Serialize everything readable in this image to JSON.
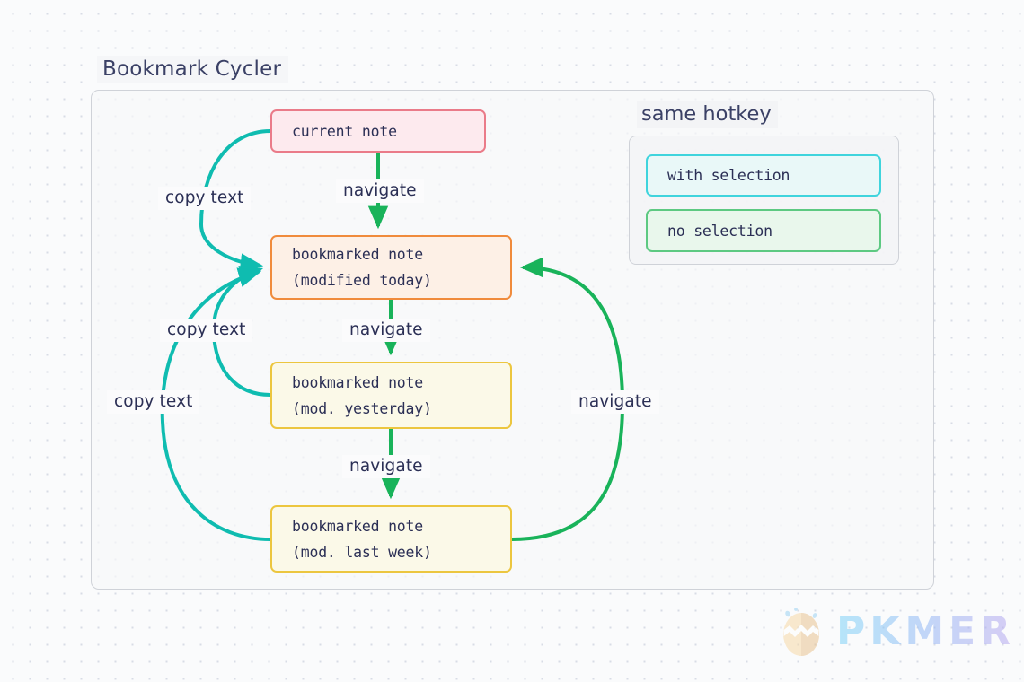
{
  "diagram": {
    "title": "Bookmark Cycler",
    "nodes": [
      {
        "id": "current",
        "label_line1": "current note",
        "label_line2": ""
      },
      {
        "id": "today",
        "label_line1": "bookmarked note",
        "label_line2": "(modified today)"
      },
      {
        "id": "yesterday",
        "label_line1": "bookmarked note",
        "label_line2": "(mod. yesterday)"
      },
      {
        "id": "lastweek",
        "label_line1": "bookmarked note",
        "label_line2": "(mod. last week)"
      }
    ],
    "edge_labels": {
      "copy_text_1": "copy text",
      "copy_text_2": "copy text",
      "copy_text_3": "copy text",
      "navigate_1": "navigate",
      "navigate_2": "navigate",
      "navigate_3": "navigate",
      "navigate_4": "navigate"
    }
  },
  "legend": {
    "title": "same hotkey",
    "items": [
      {
        "label": "with selection",
        "color": "#3fd4dd"
      },
      {
        "label": "no selection",
        "color": "#5dc982"
      }
    ]
  },
  "watermark": {
    "text": "PKMER"
  },
  "colors": {
    "page_background": "#fafbfc",
    "text": "#2b2f55",
    "title_text": "#3b4166",
    "frame_border": "#cfd2d8",
    "node_current_border": "#ea7b89",
    "node_current_fill": "#fdeaee",
    "node_today_border": "#f08b3c",
    "node_today_fill": "#fdf0e6",
    "node_bookmark_border": "#ecc63f",
    "node_bookmark_fill": "#fbf9e8",
    "edge_copy_text": "#0fbcb0",
    "edge_navigate": "#19b35a"
  }
}
